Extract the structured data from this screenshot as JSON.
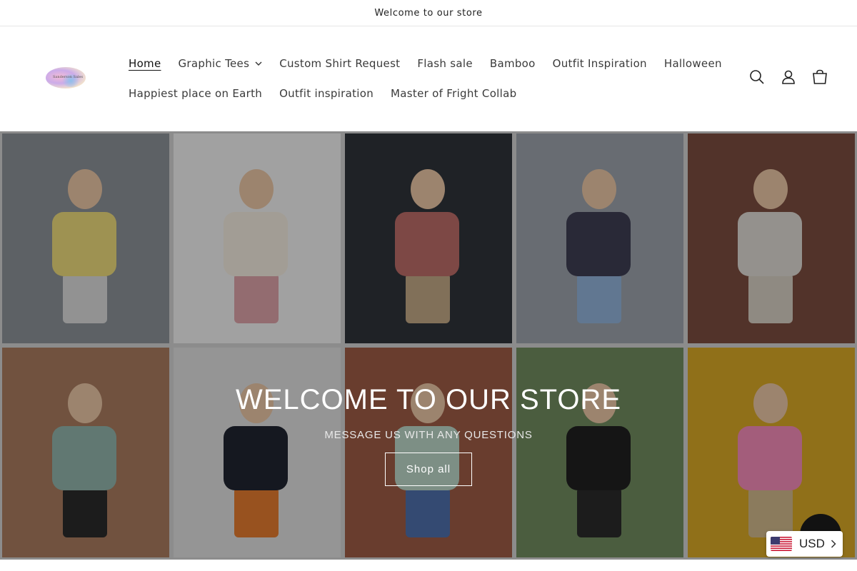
{
  "announcement": {
    "text": "Welcome to our store"
  },
  "logo": {
    "alt_text": "Sanderson Sales"
  },
  "nav": {
    "row1": [
      {
        "label": "Home",
        "active": true,
        "has_dropdown": false
      },
      {
        "label": "Graphic Tees",
        "active": false,
        "has_dropdown": true
      },
      {
        "label": "Custom Shirt Request",
        "active": false,
        "has_dropdown": false
      },
      {
        "label": "Flash sale",
        "active": false,
        "has_dropdown": false
      },
      {
        "label": "Bamboo",
        "active": false,
        "has_dropdown": false
      },
      {
        "label": "Outfit Inspiration",
        "active": false,
        "has_dropdown": false
      },
      {
        "label": "Halloween",
        "active": false,
        "has_dropdown": false
      }
    ],
    "row2": [
      {
        "label": "Happiest place on Earth"
      },
      {
        "label": "Outfit inspiration"
      },
      {
        "label": "Master of Fright Collab"
      }
    ]
  },
  "header_icons": [
    "search-icon",
    "account-icon",
    "cart-icon"
  ],
  "hero": {
    "title": "WELCOME TO OUR STORE",
    "subtitle": "MESSAGE US WITH ANY QUESTIONS",
    "button_label": "Shop all",
    "tiles": [
      {
        "bg": "#8a8f96",
        "shirt": "#e9d77a",
        "legs": "#d8d8d8"
      },
      {
        "bg": "#eeeeee",
        "shirt": "#efe8dc",
        "legs": "#d9a0a6"
      },
      {
        "bg": "#2f3338",
        "shirt": "#b86a66",
        "legs": "#bfa583"
      },
      {
        "bg": "#9aa0a8",
        "shirt": "#3d3d52",
        "legs": "#8fb0d6"
      },
      {
        "bg": "#7a4c3f",
        "shirt": "#dad6d0",
        "legs": "#d3ccc0"
      },
      {
        "bg": "#a77a5e",
        "shirt": "#8fb2a8",
        "legs": "#2a2a2a"
      },
      {
        "bg": "#dcdcdc",
        "shirt": "#1f2430",
        "legs": "#e07a2e"
      },
      {
        "bg": "#9b5a45",
        "shirt": "#b9d3c4",
        "legs": "#4d6ea8"
      },
      {
        "bg": "#6f8a5e",
        "shirt": "#1f1f1f",
        "legs": "#2a2a2a"
      },
      {
        "bg": "#d4a526",
        "shirt": "#f08ab5",
        "legs": "#cdb68a"
      }
    ]
  },
  "currency": {
    "label": "USD"
  },
  "colors": {
    "accent": "#121212",
    "overlay": "rgba(0,0,0,0.32)"
  }
}
